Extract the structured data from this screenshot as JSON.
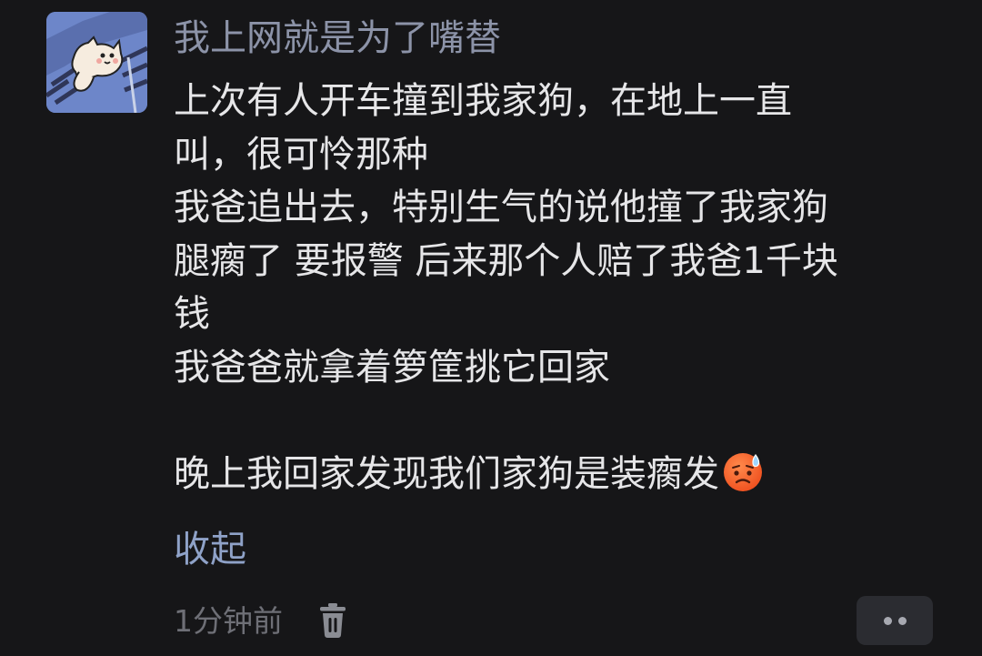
{
  "comment": {
    "author": "我上网就是为了嘴替",
    "avatar_icon": "cat-avatar-icon",
    "body_lines": [
      "上次有人开车撞到我家狗，在地上一直",
      "叫，很可怜那种",
      "我爸追出去，特别生气的说他撞了我家狗",
      "腿瘸了 要报警 后来那个人赔了我爸1千块",
      "钱",
      "我爸爸就拿着箩筐挑它回家",
      "",
      "晚上我回家发现我们家狗是装瘸发"
    ],
    "trailing_emoji": "sweat-emoji-icon",
    "collapse_label": "收起",
    "timestamp": "1分钟前",
    "delete_icon": "trash-icon",
    "more_icon": "more-dots-icon"
  },
  "colors": {
    "background": "#161618",
    "username": "#8c93a8",
    "body_text": "#e6e6e8",
    "link": "#8fa2c8",
    "meta": "#6e6f76",
    "button_bg": "#2b2c31"
  }
}
